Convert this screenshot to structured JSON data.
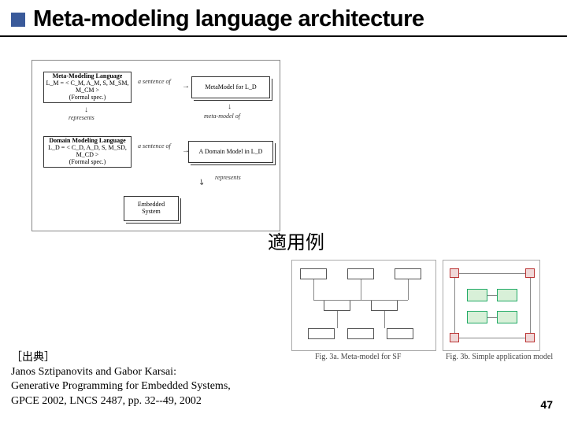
{
  "title": "Meta-modeling language architecture",
  "diagram": {
    "box_meta_lang": {
      "line1": "Meta-Modeling Language",
      "line2": "L_M = < C_M, A_M, S, M_SM, M_CM >",
      "line3": "(Formal spec.)"
    },
    "box_meta_model": "MetaModel for L_D",
    "box_domain_lang": {
      "line1": "Domain Modeling Language",
      "line2": "L_D = < C_D, A_D, S, M_SD, M_CD >",
      "line3": "(Formal spec.)"
    },
    "box_domain_model": "A Domain Model in L_D",
    "box_embedded": "Embedded\nSystem",
    "rel_sentence": "a sentence of",
    "rel_represents": "represents",
    "rel_metamodel_of": "meta-model of",
    "rel_represents_left": "represents"
  },
  "example_label": "適用例",
  "thumb_left_caption": "Fig. 3a. Meta-model for SF",
  "thumb_right_caption": "Fig. 3b. Simple application model",
  "citation": {
    "tag": "［出典］",
    "line1": "Janos Sztipanovits and Gabor Karsai:",
    "line2": "Generative Programming for Embedded Systems,",
    "line3": "GPCE 2002, LNCS 2487, pp. 32--49, 2002"
  },
  "page_number": "47"
}
